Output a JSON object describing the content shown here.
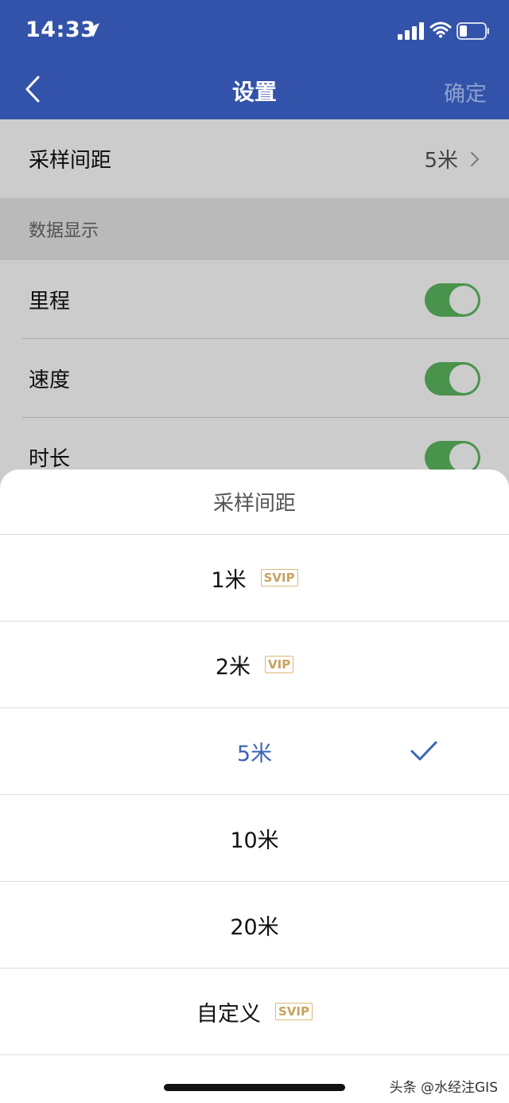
{
  "status_bar": {
    "time": "14:33"
  },
  "nav": {
    "title": "设置",
    "confirm": "确定"
  },
  "settings": {
    "sampling": {
      "label": "采样间距",
      "value": "5米"
    },
    "section_title": "数据显示",
    "toggles": [
      {
        "label": "里程",
        "on": true
      },
      {
        "label": "速度",
        "on": true
      },
      {
        "label": "时长",
        "on": true
      }
    ]
  },
  "sheet": {
    "title": "采样间距",
    "options": [
      {
        "label": "1米",
        "badge": "SVIP",
        "selected": false
      },
      {
        "label": "2米",
        "badge": "VIP",
        "selected": false
      },
      {
        "label": "5米",
        "badge": "",
        "selected": true
      },
      {
        "label": "10米",
        "badge": "",
        "selected": false
      },
      {
        "label": "20米",
        "badge": "",
        "selected": false
      },
      {
        "label": "自定义",
        "badge": "SVIP",
        "selected": false
      }
    ]
  },
  "watermark": "头条 @水经注GIS",
  "colors": {
    "header": "#3253a9",
    "accent": "#3a64b5",
    "toggle_on": "#5cb860",
    "badge": "#c9a25f"
  }
}
